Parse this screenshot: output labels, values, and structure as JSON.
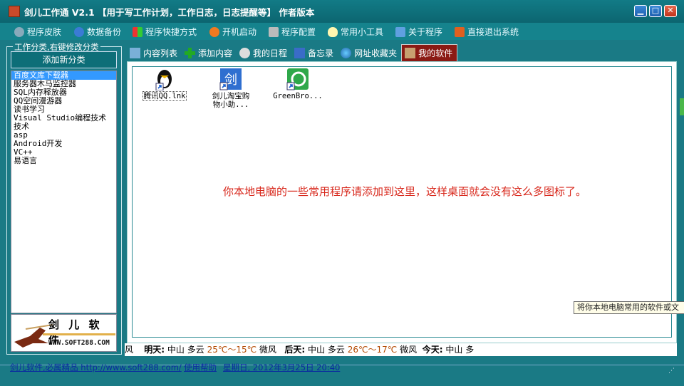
{
  "window": {
    "title": "剑儿工作通 V2.1 【用于写工作计划，工作日志，日志提醒等】 作者版本",
    "minimize": "▁",
    "maximize": "□",
    "close": "✕"
  },
  "menu": {
    "items": [
      {
        "label": "程序皮肤",
        "icon": "skin-icon"
      },
      {
        "label": "数据备份",
        "icon": "backup-icon"
      },
      {
        "label": "程序快捷方式",
        "icon": "shortcut-icon"
      },
      {
        "label": "开机启动",
        "icon": "startup-icon"
      },
      {
        "label": "程序配置",
        "icon": "config-icon"
      },
      {
        "label": "常用小工具",
        "icon": "tools-icon"
      },
      {
        "label": "关于程序",
        "icon": "about-icon"
      },
      {
        "label": "直接退出系统",
        "icon": "exit-icon"
      }
    ]
  },
  "sidebar": {
    "group_title": "工作分类,右键修改分类",
    "add_button": "添加新分类",
    "categories": [
      "百度文库下载器",
      "服务器木马监控器",
      "SQL内存释放器",
      "QQ空间漫游器",
      "读书学习",
      "Visual Studio编程技术",
      "技术",
      "asp",
      "Android开发",
      "VC++",
      "易语言"
    ],
    "selected_index": 0,
    "logo_text": "剑 儿 软 件",
    "logo_url": "WWW.SOFT288.COM"
  },
  "tabs": [
    {
      "label": "内容列表",
      "icon": "list-icon"
    },
    {
      "label": "添加内容",
      "icon": "add-icon"
    },
    {
      "label": "我的日程",
      "icon": "schedule-icon"
    },
    {
      "label": "备忘录",
      "icon": "memo-icon"
    },
    {
      "label": "网址收藏夹",
      "icon": "globe-icon"
    },
    {
      "label": "我的软件",
      "icon": "software-icon",
      "active": true
    }
  ],
  "software_items": [
    {
      "label": "腾讯QQ.lnk",
      "icon": "qq-penguin-icon"
    },
    {
      "label": "剑儿淘宝购物小助...",
      "icon": "jian-shortcut-icon"
    },
    {
      "label": "GreenBro...",
      "icon": "green-browser-icon"
    }
  ],
  "hint_text": "你本地电脑的一些常用程序请添加到这里，这样桌面就会没有这么多图标了。",
  "tooltip_text": "将你本地电脑常用的软件或文",
  "weather": {
    "prefix": "风",
    "tomorrow_label": "明天:",
    "tomorrow_city": "中山",
    "tomorrow_cond": "多云",
    "tomorrow_temp": "25℃～15℃",
    "tomorrow_wind": "微风",
    "after_label": "后天:",
    "after_city": "中山",
    "after_cond": "多云",
    "after_temp": "26℃～17℃",
    "after_wind": "微风",
    "today_label": "今天:",
    "today_city": "中山",
    "today_cond": "多"
  },
  "status": {
    "site_link": "剑儿软件,必属精品 http://www.soft288.com/",
    "help_link": "使用帮助",
    "datetime": "星期日, 2012年3月25日 20:40"
  },
  "colors": {
    "window_bg": "#1a7a85",
    "active_tab": "#8b1a14",
    "hint": "#d8281c",
    "selection": "#3399ff"
  }
}
